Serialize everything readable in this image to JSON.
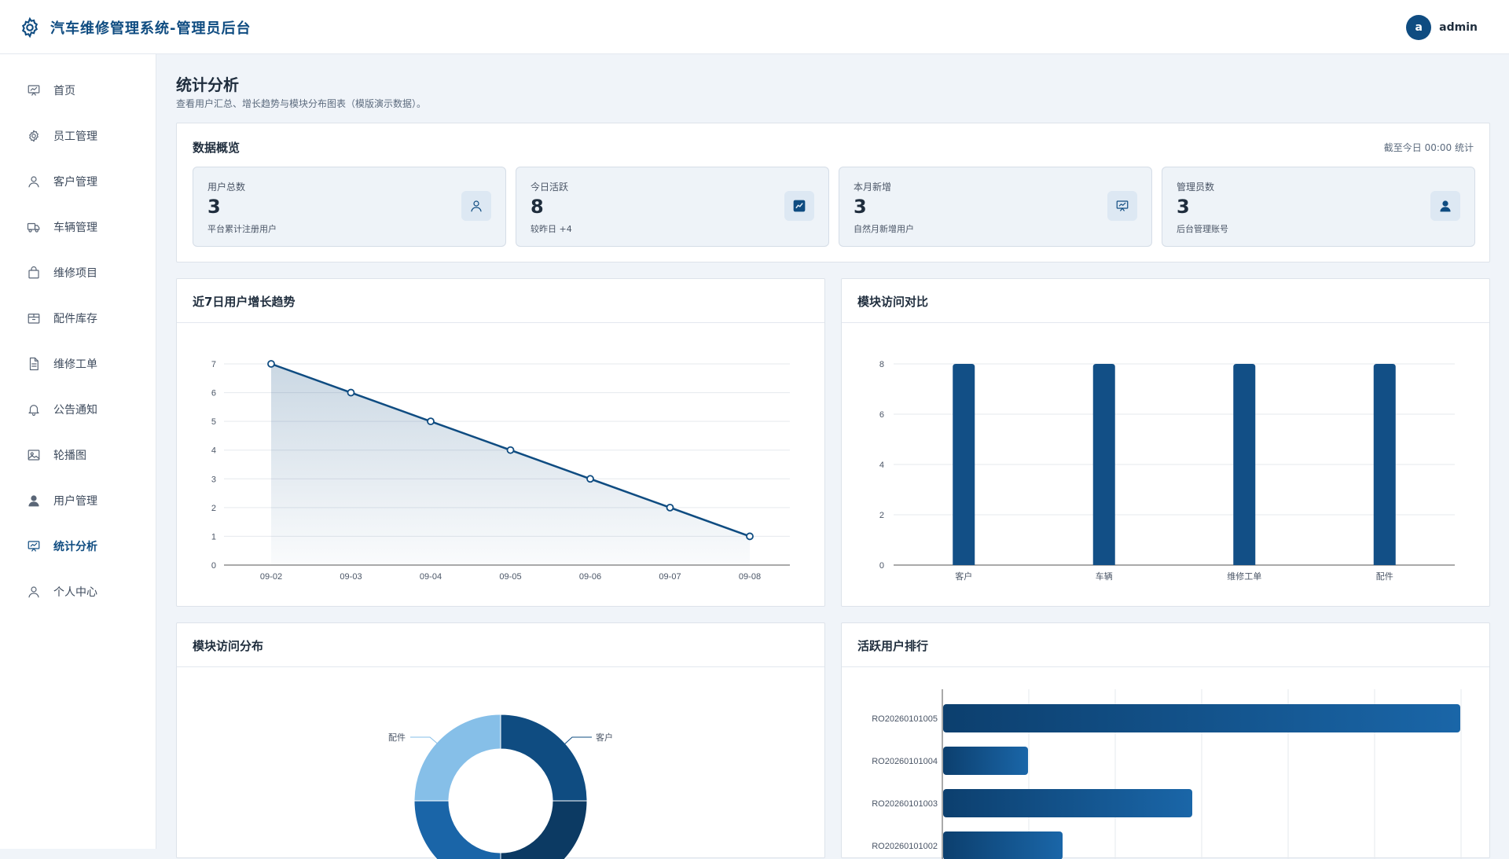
{
  "app": {
    "title": "汽车维修管理系统-管理员后台",
    "user": {
      "avatar_letter": "a",
      "name": "admin"
    }
  },
  "sidebar": {
    "items": [
      {
        "label": "首页",
        "icon": "chart-board-icon"
      },
      {
        "label": "员工管理",
        "icon": "gear-icon"
      },
      {
        "label": "客户管理",
        "icon": "user-icon"
      },
      {
        "label": "车辆管理",
        "icon": "truck-icon"
      },
      {
        "label": "维修项目",
        "icon": "bag-icon"
      },
      {
        "label": "配件库存",
        "icon": "box-icon"
      },
      {
        "label": "维修工单",
        "icon": "document-icon"
      },
      {
        "label": "公告通知",
        "icon": "bell-icon"
      },
      {
        "label": "轮播图",
        "icon": "image-icon"
      },
      {
        "label": "用户管理",
        "icon": "user-filled-icon"
      },
      {
        "label": "统计分析",
        "icon": "chart-board-icon",
        "active": true
      },
      {
        "label": "个人中心",
        "icon": "user-icon"
      }
    ]
  },
  "page": {
    "title": "统计分析",
    "subtitle": "查看用户汇总、增长趋势与模块分布图表（模版演示数据）。"
  },
  "overview": {
    "title": "数据概览",
    "note": "截至今日 00:00 统计",
    "stats": [
      {
        "label": "用户总数",
        "value": "3",
        "desc": "平台累计注册用户",
        "icon": "user-icon"
      },
      {
        "label": "今日活跃",
        "value": "8",
        "desc": "较昨日 +4",
        "icon": "trend-icon"
      },
      {
        "label": "本月新增",
        "value": "3",
        "desc": "自然月新增用户",
        "icon": "chart-board-icon"
      },
      {
        "label": "管理员数",
        "value": "3",
        "desc": "后台管理账号",
        "icon": "user-filled-icon"
      }
    ]
  },
  "panels": {
    "trend_title": "近7日用户增长趋势",
    "compare_title": "模块访问对比",
    "dist_title": "模块访问分布",
    "rank_title": "活跃用户排行"
  },
  "colors": {
    "primary": "#0f4c81",
    "bar": "#124f86",
    "pie_light": "#86bfe8",
    "pie_mid": "#1a65a8",
    "pie_dark": "#0c3a63"
  },
  "chart_data": [
    {
      "type": "area",
      "x": [
        "09-02",
        "09-03",
        "09-04",
        "09-05",
        "09-06",
        "09-07",
        "09-08"
      ],
      "values": [
        7,
        6,
        5,
        4,
        3,
        2,
        1
      ],
      "ylim": [
        0,
        7
      ],
      "yticks": [
        0,
        1,
        2,
        3,
        4,
        5,
        6,
        7
      ],
      "grid": true
    },
    {
      "type": "bar",
      "categories": [
        "客户",
        "车辆",
        "维修工单",
        "配件"
      ],
      "values": [
        8,
        8,
        8,
        8
      ],
      "ylim": [
        0,
        8
      ],
      "yticks": [
        0,
        2,
        4,
        6,
        8
      ],
      "grid": true
    },
    {
      "type": "pie",
      "labels": [
        "客户",
        "配件"
      ],
      "values": [
        25,
        25,
        25,
        25
      ]
    },
    {
      "type": "bar",
      "orientation": "horizontal",
      "categories": [
        "RO20260101005",
        "RO20260101004",
        "RO20260101003",
        "RO20260101002"
      ],
      "values": [
        6,
        1,
        2.9,
        1.4
      ],
      "xlim": [
        0,
        6
      ],
      "grid": true
    }
  ]
}
